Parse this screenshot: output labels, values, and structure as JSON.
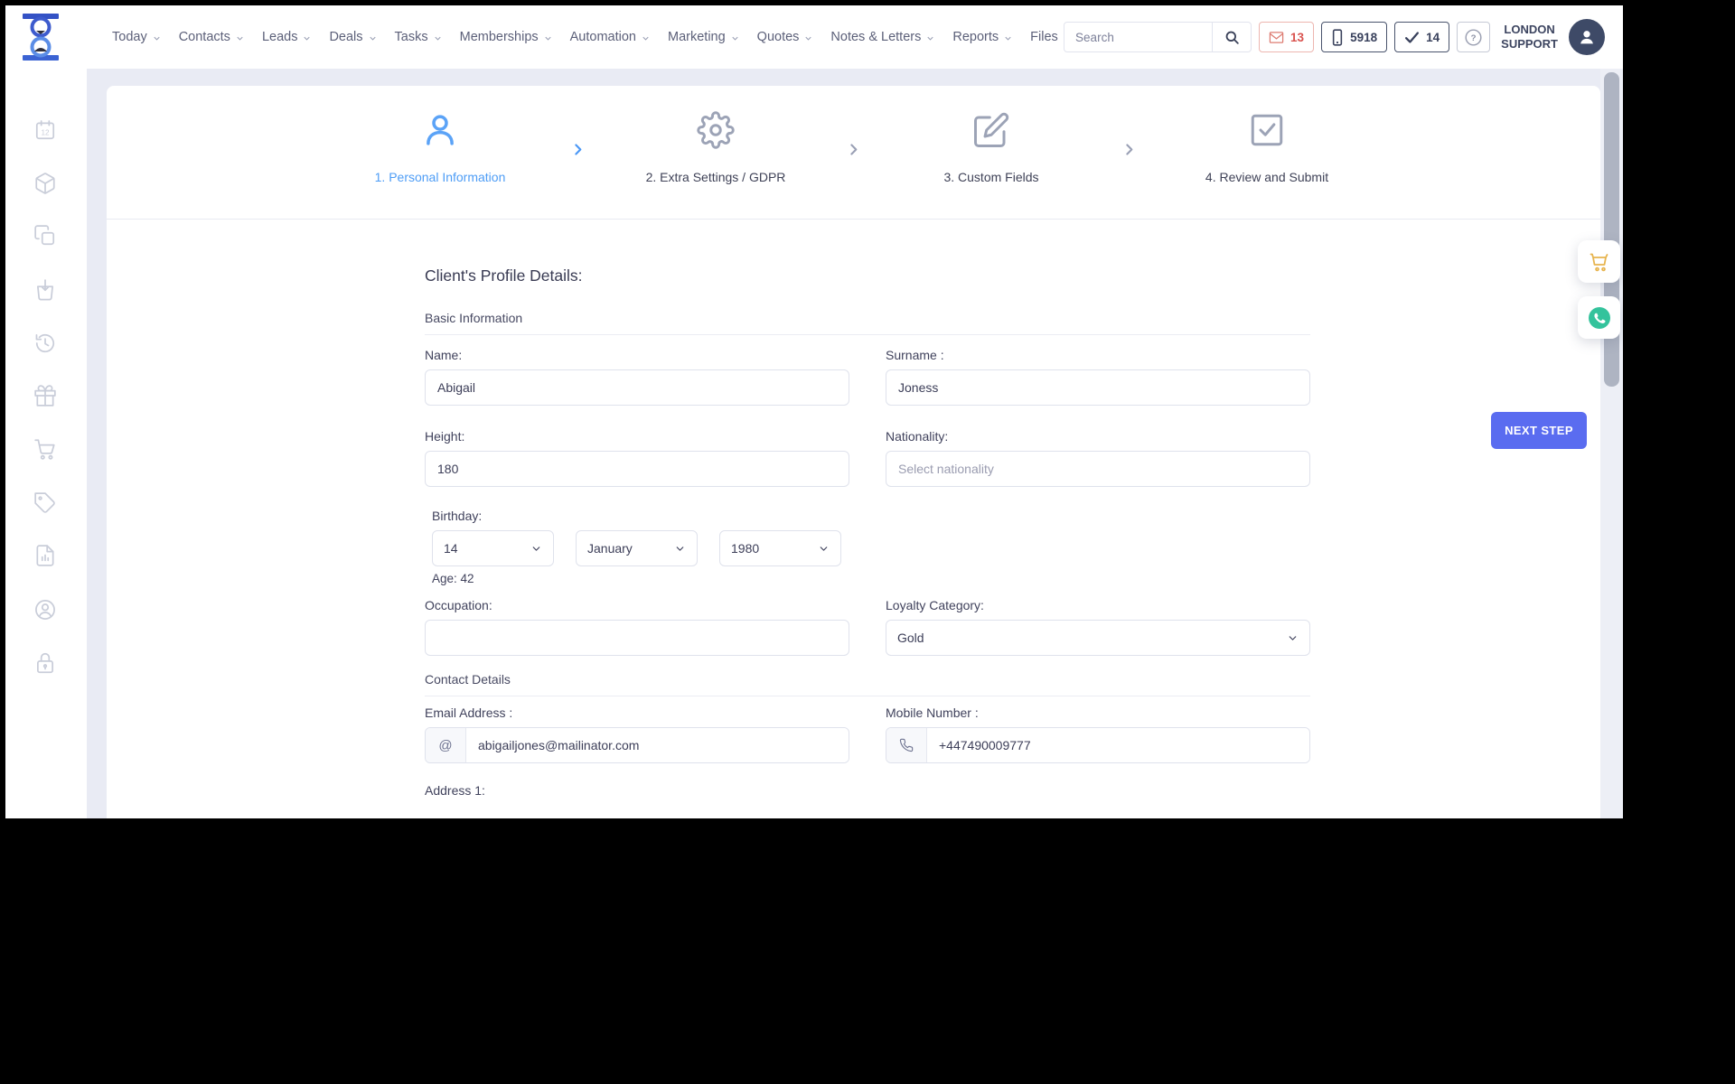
{
  "colors": {
    "accent_blue": "#5a6cf0",
    "active_step_blue": "#4e9df6",
    "badge_red": "#d9534f",
    "navy": "#39415c",
    "cart_gold": "#e7b44e",
    "whatsapp_green": "#34c39c",
    "sidebar_icon_gray": "#c9cdd9",
    "main_bg": "#e9ebf4"
  },
  "navbar": {
    "menu": [
      {
        "label": "Today"
      },
      {
        "label": "Contacts"
      },
      {
        "label": "Leads"
      },
      {
        "label": "Deals"
      },
      {
        "label": "Tasks"
      },
      {
        "label": "Memberships"
      },
      {
        "label": "Automation"
      },
      {
        "label": "Marketing"
      },
      {
        "label": "Quotes"
      },
      {
        "label": "Notes & Letters"
      },
      {
        "label": "Reports"
      },
      {
        "label": "Files"
      }
    ],
    "search": {
      "placeholder": "Search"
    },
    "badges": {
      "messages": "13",
      "calls": "5918",
      "tasks": "14"
    },
    "support": {
      "line1": "LONDON",
      "line2": "SUPPORT"
    }
  },
  "sidebar": {
    "icons": [
      "calendar",
      "package",
      "copy",
      "bag-receive",
      "history",
      "gift",
      "cart",
      "tags",
      "report",
      "account",
      "lock"
    ]
  },
  "wizard": {
    "steps": [
      {
        "label": "1. Personal Information",
        "icon": "person",
        "active": true
      },
      {
        "label": "2. Extra Settings / GDPR",
        "icon": "gear",
        "active": false
      },
      {
        "label": "3. Custom Fields",
        "icon": "edit",
        "active": false
      },
      {
        "label": "4. Review and Submit",
        "icon": "check-square",
        "active": false
      }
    ]
  },
  "form": {
    "title": "Client's Profile Details:",
    "basic_section": "Basic Information",
    "contact_section": "Contact Details",
    "name": {
      "label": "Name:",
      "value": "Abigail"
    },
    "surname": {
      "label": "Surname :",
      "value": "Joness"
    },
    "height": {
      "label": "Height:",
      "value": "180"
    },
    "nationality": {
      "label": "Nationality:",
      "placeholder": "Select nationality"
    },
    "birthday": {
      "label": "Birthday:",
      "day": "14",
      "month": "January",
      "year": "1980",
      "age": "Age: 42"
    },
    "occupation": {
      "label": "Occupation:",
      "value": ""
    },
    "loyalty": {
      "label": "Loyalty Category:",
      "value": "Gold"
    },
    "email": {
      "label": "Email Address :",
      "prefix": "@",
      "value": "abigailjones@mailinator.com"
    },
    "mobile": {
      "label": "Mobile Number :",
      "value": "+447490009777"
    },
    "address1": {
      "label": "Address 1:"
    },
    "next_button": "NEXT STEP"
  }
}
